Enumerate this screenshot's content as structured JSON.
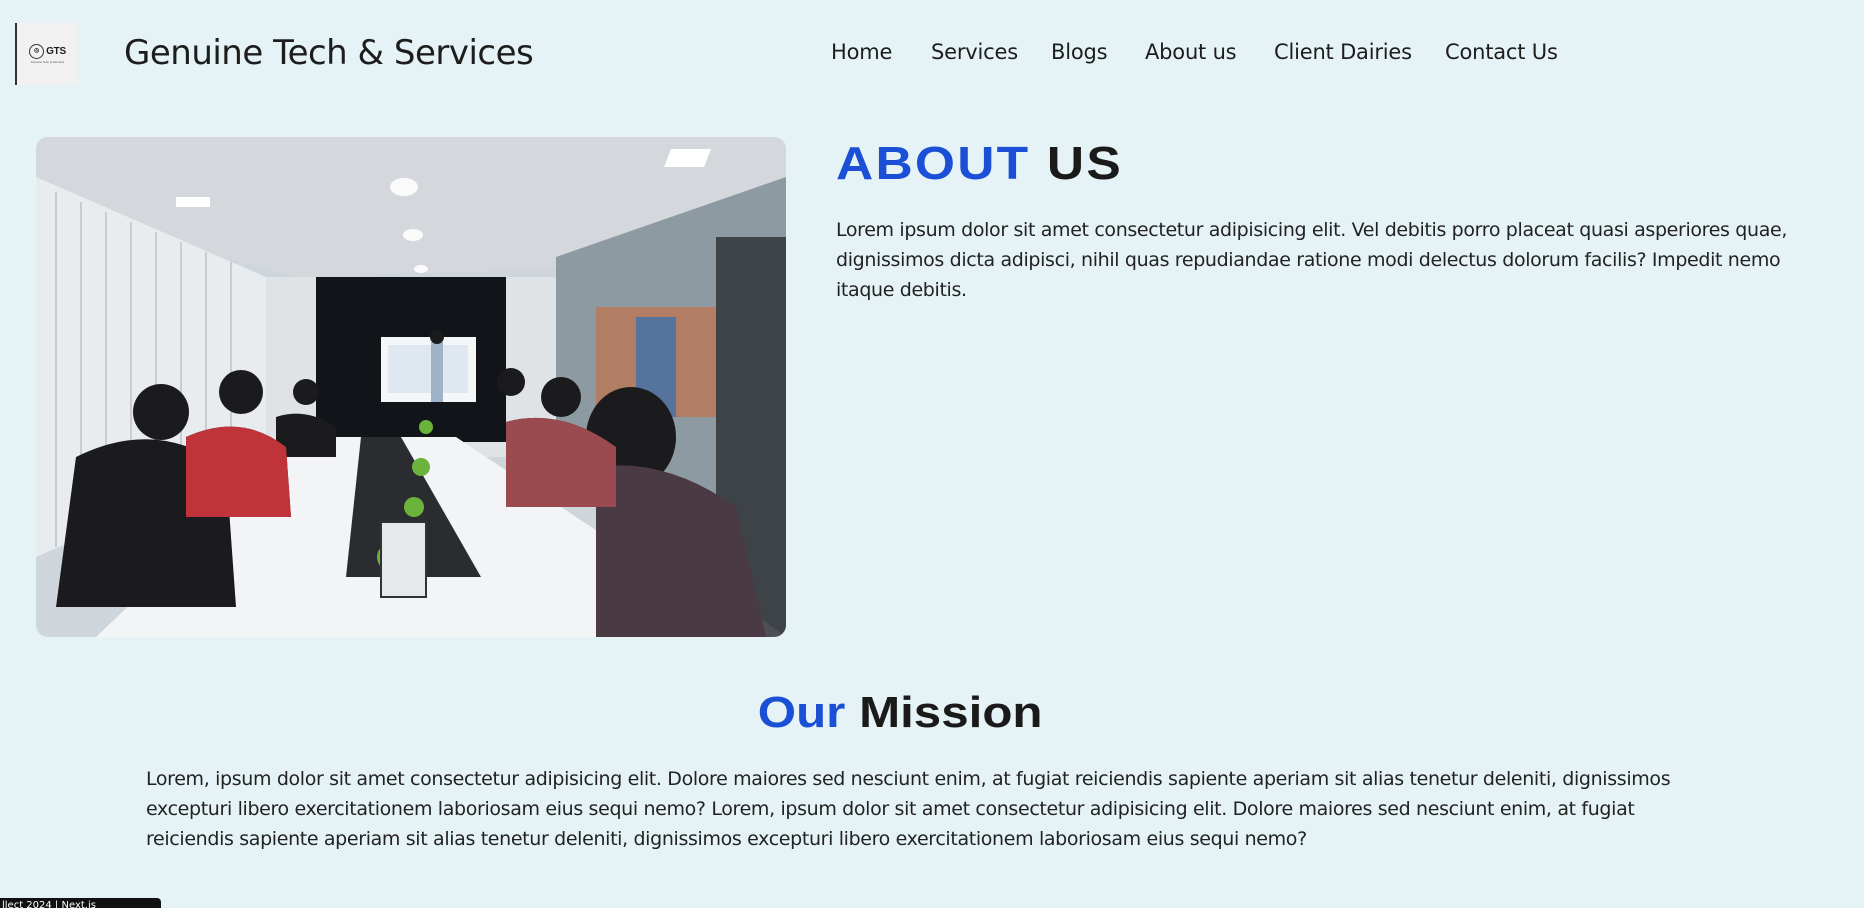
{
  "header": {
    "logo": {
      "mark": "GTS",
      "tagline": "Genuine Tech & Services"
    },
    "brand": "Genuine Tech & Services",
    "nav": [
      {
        "label": "Home"
      },
      {
        "label": "Services"
      },
      {
        "label": "Blogs"
      },
      {
        "label": "About us"
      },
      {
        "label": "Client Dairies"
      },
      {
        "label": "Contact Us"
      }
    ]
  },
  "about": {
    "title_accent": "ABOUT",
    "title_rest": "US",
    "text": "Lorem ipsum dolor sit amet consectetur adipisicing elit. Vel debitis porro placeat quasi asperiores quae, dignissimos dicta adipisci, nihil quas repudiandae ratione modi delectus dolorum facilis? Impedit nemo itaque debitis."
  },
  "mission": {
    "title_accent": "Our",
    "title_rest": "Mission",
    "text": "Lorem, ipsum dolor sit amet consectetur adipisicing elit. Dolore maiores sed nesciunt enim, at fugiat reiciendis sapiente aperiam sit alias tenetur deleniti, dignissimos excepturi libero exercitationem laboriosam eius sequi nemo? Lorem, ipsum dolor sit amet consectetur adipisicing elit. Dolore maiores sed nesciunt enim, at fugiat reiciendis sapiente aperiam sit alias tenetur deleniti, dignissimos excepturi libero exercitationem laboriosam eius sequi nemo?"
  },
  "footer": {
    "badge": "llect 2024 | Next.js"
  },
  "colors": {
    "accent": "#1a4fd6",
    "background": "#e6f3f6",
    "text": "#1c1c1c"
  }
}
